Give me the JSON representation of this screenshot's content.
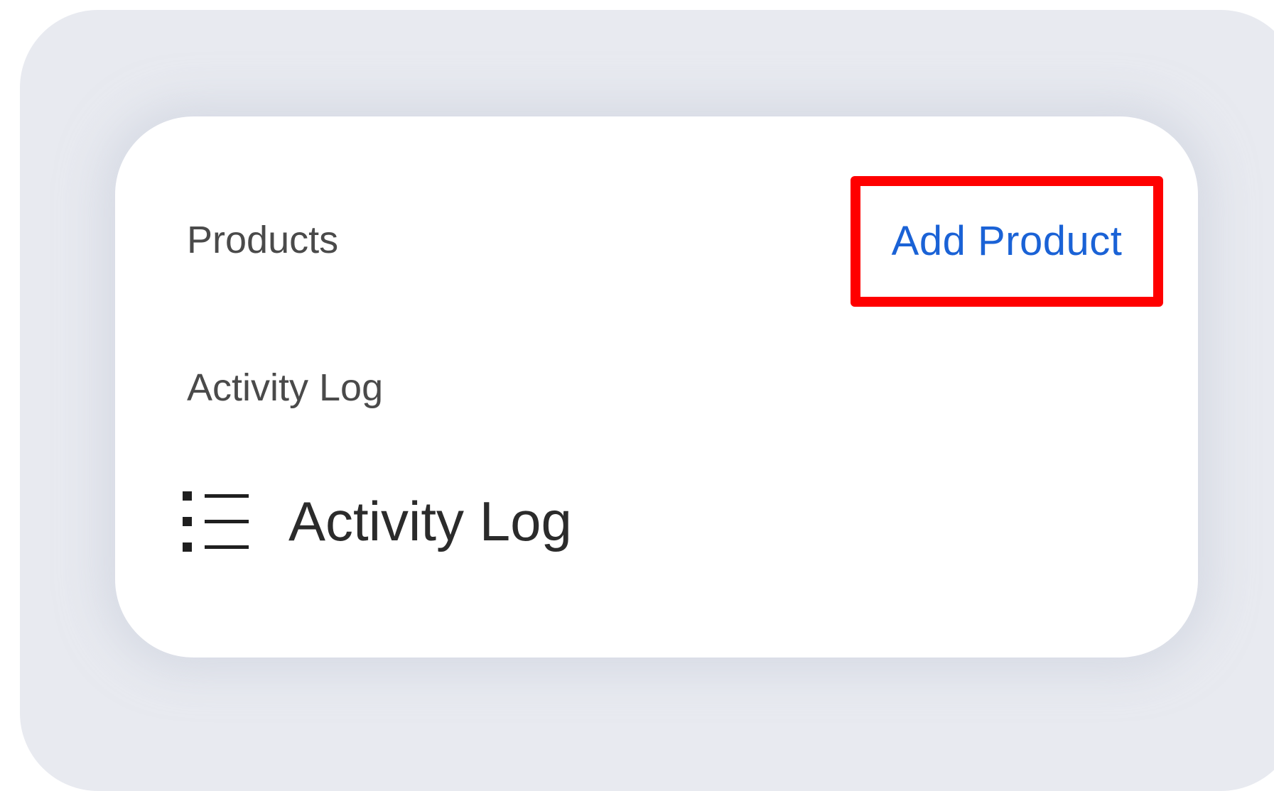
{
  "sections": {
    "products_label": "Products",
    "add_product_label": "Add Product",
    "activity_heading": "Activity Log",
    "activity_item_label": "Activity Log",
    "activity_item_icon": "list-icon"
  },
  "colors": {
    "link": "#1a62d6",
    "highlight": "#ff0000",
    "background_panel": "#e8eaf0",
    "card": "#ffffff",
    "text": "#4a4a4a"
  }
}
